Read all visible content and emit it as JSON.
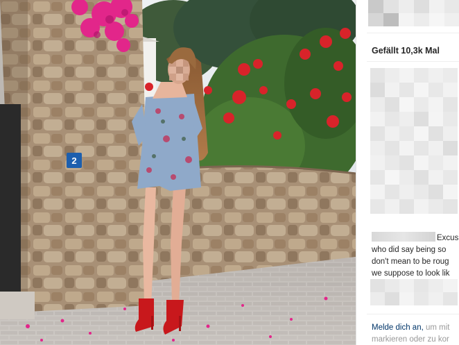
{
  "image": {
    "house_number": "2",
    "alt": "Photo of a woman in a floral playsuit standing by a stone wall"
  },
  "post": {
    "likes_label": "Gefällt 10,3k Mal",
    "comment_lines": [
      "Excus",
      "who did say being so",
      "don't mean to be roug",
      "we suppose to look lik"
    ],
    "login_link": "Melde dich an,",
    "login_rest_1": " um mit",
    "login_rest_2": "markieren oder zu kor"
  },
  "colors": {
    "accent_link": "#003569",
    "text": "#262626",
    "muted": "#999999",
    "flower_red": "#d8232a",
    "bougainvillea": "#e2268a",
    "sign_blue": "#1d5fae"
  }
}
